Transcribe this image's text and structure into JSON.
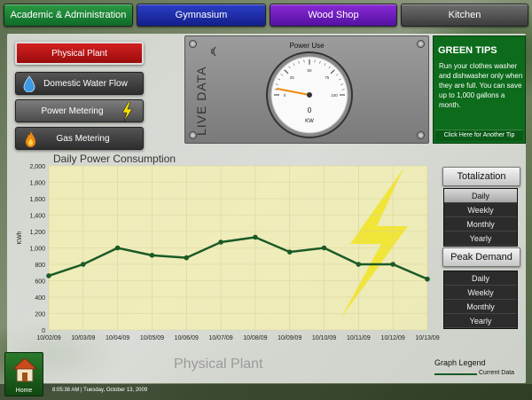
{
  "tabs": [
    {
      "label": "Academic & Administration"
    },
    {
      "label": "Gymnasium"
    },
    {
      "label": "Wood Shop"
    },
    {
      "label": "Kitchen"
    }
  ],
  "left_menu": {
    "physical_plant": "Physical Plant",
    "domestic_water": "Domestic Water Flow",
    "power_metering": "Power Metering",
    "gas_metering": "Gas Metering"
  },
  "gauge": {
    "title": "Power Use",
    "live_label": "LIVE DATA",
    "value": "0",
    "unit": "KW",
    "ticks": [
      "0",
      "25",
      "50",
      "75",
      "100"
    ],
    "needle_value": 6
  },
  "tips": {
    "title": "GREEN TIPS",
    "text": "Run your clothes washer and dishwasher only when they are full. You can save up to 1,000 gallons a month.",
    "button": "Click Here for Another Tip"
  },
  "chart_data": {
    "type": "line",
    "title": "Daily Power Consumption",
    "ylabel": "KWh",
    "ylim": [
      0,
      2000
    ],
    "yticks": [
      "0",
      "200",
      "400",
      "600",
      "800",
      "1,000",
      "1,200",
      "1,400",
      "1,600",
      "1,800",
      "2,000"
    ],
    "categories": [
      "10/02/09",
      "10/03/09",
      "10/04/09",
      "10/05/09",
      "10/06/09",
      "10/07/09",
      "10/08/09",
      "10/09/09",
      "10/10/09",
      "10/11/09",
      "10/12/09",
      "10/13/09"
    ],
    "series": [
      {
        "name": "Current Data",
        "values": [
          660,
          800,
          1000,
          910,
          880,
          1070,
          1130,
          950,
          1000,
          800,
          800,
          620
        ]
      }
    ],
    "grid": true,
    "legend": "bottom-right"
  },
  "totalization": {
    "title": "Totalization",
    "items": [
      {
        "label": "Daily",
        "active": true
      },
      {
        "label": "Weekly",
        "active": false
      },
      {
        "label": "Monthly",
        "active": false
      },
      {
        "label": "Yearly",
        "active": false
      }
    ]
  },
  "peak_demand": {
    "title": "Peak Demand",
    "items": [
      {
        "label": "Daily"
      },
      {
        "label": "Weekly"
      },
      {
        "label": "Monthly"
      },
      {
        "label": "Yearly"
      }
    ]
  },
  "footer": {
    "section_label": "Physical Plant",
    "legend_title": "Graph Legend",
    "legend_item": "Current Data",
    "home_label": "Home",
    "datetime": "8:05:38 AM | Tuesday, October 13, 2009"
  },
  "colors": {
    "line": "#1a5a25",
    "chart_fill": "#f6f2b0",
    "tips_bg": "#0d6b1c"
  }
}
